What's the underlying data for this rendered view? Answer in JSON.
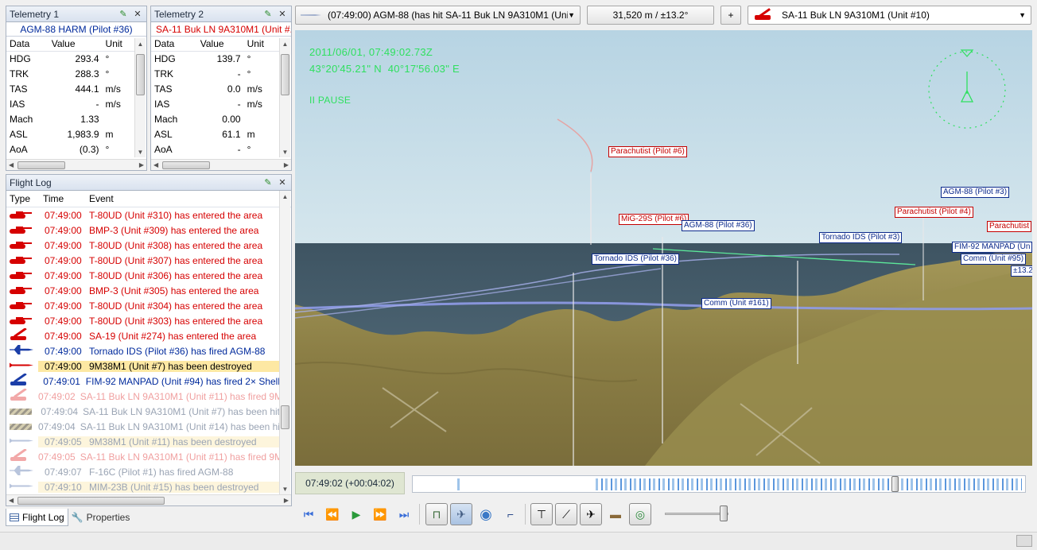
{
  "telemetry1": {
    "title": "Telemetry 1",
    "subject": "AGM-88 HARM (Pilot #36)",
    "headers": [
      "Data",
      "Value",
      "Unit"
    ],
    "rows": [
      [
        "HDG",
        "293.4",
        "°"
      ],
      [
        "TRK",
        "288.3",
        "°"
      ],
      [
        "TAS",
        "444.1",
        "m/s"
      ],
      [
        "IAS",
        "-",
        "m/s"
      ],
      [
        "Mach",
        "1.33",
        ""
      ],
      [
        "ASL",
        "1,983.9",
        "m"
      ],
      [
        "AoA",
        "(0.3)",
        "°"
      ]
    ]
  },
  "telemetry2": {
    "title": "Telemetry 2",
    "subject": "SA-11 Buk LN 9A310M1 (Unit #...",
    "headers": [
      "Data",
      "Value",
      "Unit"
    ],
    "rows": [
      [
        "HDG",
        "139.7",
        "°"
      ],
      [
        "TRK",
        "-",
        "°"
      ],
      [
        "TAS",
        "0.0",
        "m/s"
      ],
      [
        "IAS",
        "-",
        "m/s"
      ],
      [
        "Mach",
        "0.00",
        ""
      ],
      [
        "ASL",
        "61.1",
        "m"
      ],
      [
        "AoA",
        "-",
        "°"
      ]
    ]
  },
  "flightlog": {
    "title": "Flight Log",
    "headers": [
      "Type",
      "Time",
      "Event"
    ],
    "rows": [
      {
        "time": "07:49:00",
        "event": "T-80UD (Unit #310) has entered the area",
        "style": "red",
        "icon": "tank-icon"
      },
      {
        "time": "07:49:00",
        "event": "BMP-3 (Unit #309) has entered the area",
        "style": "red",
        "icon": "tank-icon"
      },
      {
        "time": "07:49:00",
        "event": "T-80UD (Unit #308) has entered the area",
        "style": "red",
        "icon": "tank-icon"
      },
      {
        "time": "07:49:00",
        "event": "T-80UD (Unit #307) has entered the area",
        "style": "red",
        "icon": "tank-icon"
      },
      {
        "time": "07:49:00",
        "event": "T-80UD (Unit #306) has entered the area",
        "style": "red",
        "icon": "tank-icon"
      },
      {
        "time": "07:49:00",
        "event": "BMP-3 (Unit #305) has entered the area",
        "style": "red",
        "icon": "tank-icon"
      },
      {
        "time": "07:49:00",
        "event": "T-80UD (Unit #304) has entered the area",
        "style": "red",
        "icon": "tank-icon"
      },
      {
        "time": "07:49:00",
        "event": "T-80UD (Unit #303) has entered the area",
        "style": "red",
        "icon": "tank-icon"
      },
      {
        "time": "07:49:00",
        "event": "SA-19 (Unit #274) has entered the area",
        "style": "red",
        "icon": "sam-launcher-icon"
      },
      {
        "time": "07:49:00",
        "event": "Tornado IDS (Pilot #36) has fired AGM-88",
        "style": "blue",
        "icon": "jet-icon"
      },
      {
        "time": "07:49:00",
        "event": "9M38M1 (Unit #7) has been destroyed",
        "style": "hl",
        "icon": "missile-icon"
      },
      {
        "time": "07:49:01",
        "event": "FIM-92 MANPAD (Unit #94) has fired 2× Shell",
        "style": "blue",
        "icon": "sam-launcher-icon"
      },
      {
        "time": "07:49:02",
        "event": "SA-11 Buk LN 9A310M1 (Unit #11) has fired 9M",
        "style": "faded-red",
        "icon": "sam-launcher-icon"
      },
      {
        "time": "07:49:04",
        "event": "SA-11 Buk LN 9A310M1 (Unit #7) has been hit",
        "style": "faded",
        "icon": "striped-icon"
      },
      {
        "time": "07:49:04",
        "event": "SA-11 Buk LN 9A310M1 (Unit #14) has been hit",
        "style": "faded",
        "icon": "striped-icon"
      },
      {
        "time": "07:49:05",
        "event": "9M38M1 (Unit #11) has been destroyed",
        "style": "fadedbg",
        "icon": "missile-icon"
      },
      {
        "time": "07:49:05",
        "event": "SA-11 Buk LN 9A310M1 (Unit #11) has fired 9M",
        "style": "faded-red",
        "icon": "sam-launcher-icon"
      },
      {
        "time": "07:49:07",
        "event": "F-16C (Pilot #1) has fired AGM-88",
        "style": "faded",
        "icon": "jet-icon"
      },
      {
        "time": "07:49:10",
        "event": "MIM-23B (Unit #15) has been destroyed",
        "style": "fadedbg",
        "icon": "missile-icon"
      }
    ]
  },
  "bottom_tabs": {
    "flight_log": "Flight Log",
    "properties": "Properties"
  },
  "toolbar": {
    "event_select": "(07:49:00) AGM-88 (has hit SA-11 Buk LN 9A310M1 (Uni...",
    "range": "31,520 m / ±13.2°",
    "plus": "+",
    "target_select": "SA-11 Buk LN 9A310M1 (Unit #10)"
  },
  "hud": {
    "datetime": "2011/06/01, 07:49:02.73Z",
    "coords": "43°20'45.21\" N  40°17'56.03\" E",
    "pause": "II PAUSE"
  },
  "labels": [
    {
      "text": "Parachutist (Pilot #6)",
      "side": "r"
    },
    {
      "text": "MiG-29S (Pilot #6)",
      "side": "r"
    },
    {
      "text": "AGM-88 (Pilot #36)",
      "side": "b"
    },
    {
      "text": "Tornado IDS (Pilot #36)",
      "side": "b"
    },
    {
      "text": "Tornado IDS (Pilot #3)",
      "side": "b"
    },
    {
      "text": "AGM-88 (Pilot #3)",
      "side": "b"
    },
    {
      "text": "Parachutist (Pilot #4)",
      "side": "r"
    },
    {
      "text": "Parachutist",
      "side": "r"
    },
    {
      "text": "FIM-92 MANPAD (Un",
      "side": "b"
    },
    {
      "text": "Comm (Unit #95)",
      "side": "b"
    },
    {
      "text": "±13.2",
      "side": "b"
    },
    {
      "text": "Comm (Unit #161)",
      "side": "b"
    }
  ],
  "timeline": {
    "time": "07:49:02 (+00:04:02)",
    "position_fraction": 0.792
  },
  "colors": {
    "hud_green": "#2fe05f",
    "red_coalition": "#d60000",
    "blue_coalition": "#002a9c",
    "highlight": "#fde8a3"
  }
}
